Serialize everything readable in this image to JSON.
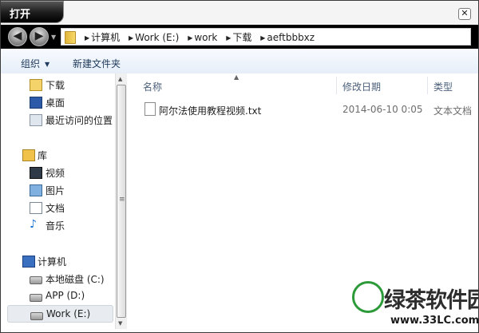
{
  "dialog": {
    "title": "打开",
    "close_glyph": "✕"
  },
  "address": {
    "crumbs": [
      "计算机",
      "Work (E:)",
      "work",
      "下载",
      "aeftbbbxz"
    ]
  },
  "toolbar": {
    "organize": "组织",
    "new_folder": "新建文件夹"
  },
  "sidebar": {
    "favorites": [
      {
        "label": "下载",
        "icon": "downloads-folder-icon"
      },
      {
        "label": "桌面",
        "icon": "desktop-icon"
      },
      {
        "label": "最近访问的位置",
        "icon": "recent-places-icon"
      }
    ],
    "libraries": {
      "label": "库",
      "items": [
        {
          "label": "视频",
          "icon": "video-library-icon"
        },
        {
          "label": "图片",
          "icon": "pictures-library-icon"
        },
        {
          "label": "文档",
          "icon": "documents-library-icon"
        },
        {
          "label": "音乐",
          "icon": "music-library-icon"
        }
      ]
    },
    "computer": {
      "label": "计算机",
      "items": [
        {
          "label": "本地磁盘 (C:)",
          "icon": "local-disk-icon"
        },
        {
          "label": "APP (D:)",
          "icon": "drive-icon"
        },
        {
          "label": "Work (E:)",
          "icon": "drive-icon",
          "selected": true
        }
      ]
    }
  },
  "filelist": {
    "columns": {
      "name": "名称",
      "modified": "修改日期",
      "type": "类型"
    },
    "rows": [
      {
        "name": "阿尔法使用教程视频.txt",
        "modified": "2014-06-10 0:05",
        "type": "文本文档"
      }
    ]
  },
  "watermark": {
    "name": "绿茶软件园",
    "url": "www.33LC.com"
  }
}
